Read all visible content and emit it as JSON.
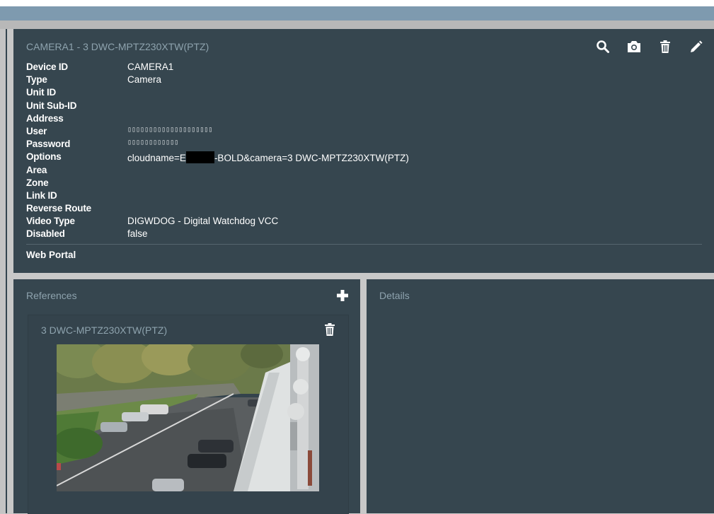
{
  "device": {
    "title": "CAMERA1 - 3 DWC-MPTZ230XTW(PTZ)",
    "fields": [
      {
        "label": "Device ID",
        "value": "CAMERA1"
      },
      {
        "label": "Type",
        "value": "Camera"
      },
      {
        "label": "Unit ID",
        "value": ""
      },
      {
        "label": "Unit Sub-ID",
        "value": ""
      },
      {
        "label": "Address",
        "value": ""
      },
      {
        "label": "User",
        "value": "▯▯▯▯▯▯▯▯▯▯▯▯▯▯▯▯▯▯▯▯"
      },
      {
        "label": "Password",
        "value": "▯▯▯▯▯▯▯▯▯▯▯▯"
      },
      {
        "label": "Options",
        "value_prefix": "cloudname=E",
        "value_suffix": "-BOLD&camera=3 DWC-MPTZ230XTW(PTZ)"
      },
      {
        "label": "Area",
        "value": ""
      },
      {
        "label": "Zone",
        "value": ""
      },
      {
        "label": "Link ID",
        "value": ""
      },
      {
        "label": "Reverse Route",
        "value": ""
      },
      {
        "label": "Video Type",
        "value": "DIGWDOG - Digital Watchdog VCC"
      },
      {
        "label": "Disabled",
        "value": "false"
      }
    ],
    "web_portal_label": "Web Portal",
    "toolbar": [
      "search-icon",
      "camera-icon",
      "trash-icon",
      "pencil-icon"
    ]
  },
  "references": {
    "title": "References",
    "add_icon": "plus-icon",
    "cards": [
      {
        "title": "3 DWC-MPTZ230XTW(PTZ)",
        "delete_icon": "trash-icon"
      }
    ]
  },
  "details": {
    "title": "Details"
  },
  "colors": {
    "panel_bg": "#36464f",
    "title_text": "#8ea3ae",
    "header_strip": "#7e9aaf"
  }
}
